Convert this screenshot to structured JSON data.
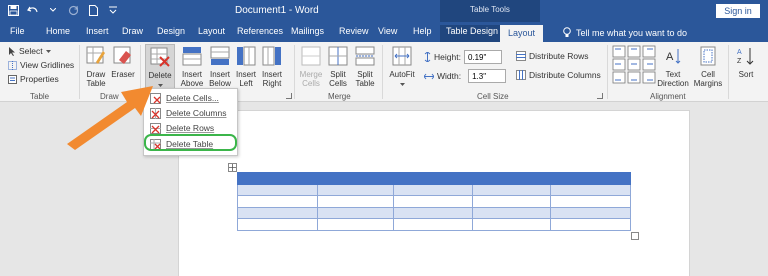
{
  "window": {
    "document_title": "Document1 - Word",
    "context_label": "Table Tools",
    "sign_in": "Sign in"
  },
  "tabs": [
    "File",
    "Home",
    "Insert",
    "Draw",
    "Design",
    "Layout",
    "References",
    "Mailings",
    "Review",
    "View",
    "Help",
    "Table Design",
    "Layout"
  ],
  "tell_me": "Tell me what you want to do",
  "ribbon": {
    "table_group": {
      "select": "Select",
      "view_gridlines": "View Gridlines",
      "properties": "Properties",
      "label": "Table"
    },
    "draw_group": {
      "draw_table": [
        "Draw",
        "Table"
      ],
      "eraser": "Eraser",
      "label": "Draw"
    },
    "rows_cols": {
      "delete": "Delete",
      "insert_above": [
        "Insert",
        "Above"
      ],
      "insert_below": [
        "Insert",
        "Below"
      ],
      "insert_left": [
        "Insert",
        "Left"
      ],
      "insert_right": [
        "Insert",
        "Right"
      ]
    },
    "merge_group": {
      "merge_cells": [
        "Merge",
        "Cells"
      ],
      "split_cells": [
        "Split",
        "Cells"
      ],
      "split_table": [
        "Split",
        "Table"
      ],
      "label": "Merge"
    },
    "cell_size": {
      "autofit": "AutoFit",
      "height_label": "Height:",
      "height_value": "0.19\"",
      "width_label": "Width:",
      "width_value": "1.3\"",
      "distribute_rows": "Distribute Rows",
      "distribute_columns": "Distribute Columns",
      "label": "Cell Size"
    },
    "alignment": {
      "text_direction": [
        "Text",
        "Direction"
      ],
      "cell_margins": [
        "Cell",
        "Margins"
      ],
      "label": "Alignment"
    },
    "data_group": {
      "sort": "Sort"
    }
  },
  "delete_menu": {
    "items": [
      "Delete Cells...",
      "Delete Columns",
      "Delete Rows",
      "Delete Table"
    ]
  },
  "colors": {
    "word_blue": "#2b579a",
    "table_header": "#4472c4",
    "table_band": "#d9e2f3",
    "arrow": "#f28a30",
    "highlight": "#3bb54a"
  }
}
